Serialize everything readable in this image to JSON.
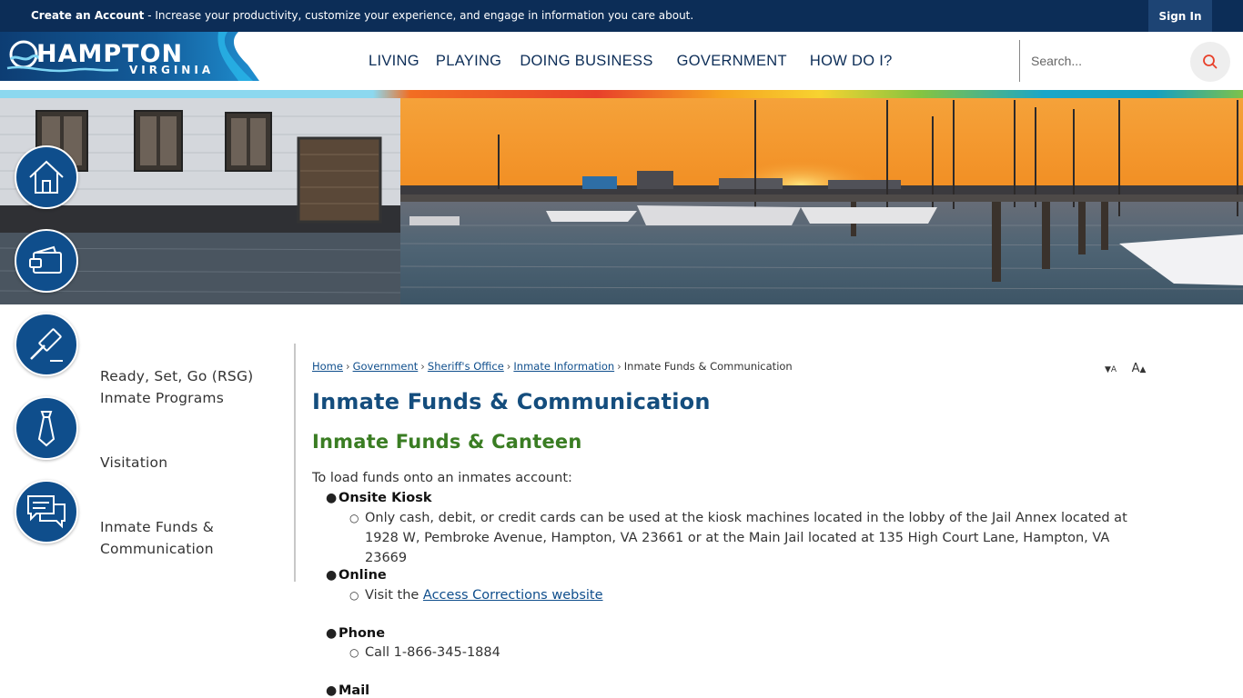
{
  "topbar": {
    "create_account_label": "Create an Account",
    "promo_text": " - Increase your productivity, customize your experience, and engage in information you care about.",
    "sign_in_label": "Sign In"
  },
  "header": {
    "logo_main": "HAMPTON",
    "logo_sub": "VIRGINIA",
    "nav": [
      "LIVING",
      "PLAYING",
      "DOING BUSINESS",
      "GOVERNMENT",
      "HOW DO I?"
    ],
    "search_placeholder": "Search..."
  },
  "quick_links": [
    {
      "icon": "home-icon"
    },
    {
      "icon": "wallet-icon"
    },
    {
      "icon": "gavel-icon"
    },
    {
      "icon": "tie-icon"
    },
    {
      "icon": "chat-icon"
    }
  ],
  "sidenav": {
    "items": [
      "Ready, Set, Go (RSG) Inmate Programs",
      "Visitation",
      "Inmate Funds & Communication"
    ]
  },
  "breadcrumb": {
    "links": [
      "Home",
      "Government",
      "Sheriff's Office",
      "Inmate Information"
    ],
    "current": "Inmate Funds & Communication",
    "separator": "›"
  },
  "font_controls": {
    "decrease": "A",
    "increase": "A"
  },
  "content": {
    "title": "Inmate Funds & Communication",
    "subtitle": "Inmate Funds & Canteen",
    "intro": "To load funds onto an inmates account:",
    "methods": [
      {
        "label": "Onsite Kiosk",
        "detail": "Only cash, debit, or credit cards can be used at the kiosk machines located in the lobby of the Jail Annex located at 1928 W, Pembroke Avenue, Hampton, VA 23661 or at the Main Jail located at 135 High Court Lane, Hampton, VA 23669"
      },
      {
        "label": "Online",
        "detail_prefix": "Visit the ",
        "link_text": "Access Corrections website"
      },
      {
        "label": "Phone",
        "detail": "Call 1-866-345-1884"
      },
      {
        "label": "Mail"
      }
    ]
  },
  "colors": {
    "navy": "#0c2d57",
    "link_blue": "#0f4e8c",
    "heading_green": "#3a7d23",
    "search_red": "#e8402a"
  }
}
